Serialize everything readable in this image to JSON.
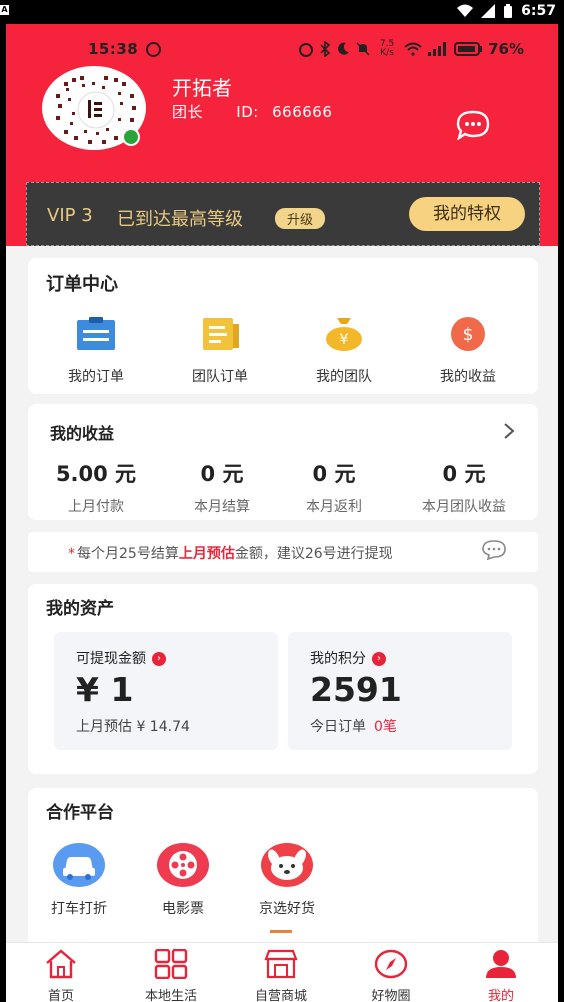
{
  "system_bar": {
    "time": "6:57",
    "app_letter": "A"
  },
  "inner_status": {
    "time": "15:38",
    "speed": "7.5 K/s",
    "battery": "76%"
  },
  "user": {
    "name": "开拓者",
    "role": "团长",
    "id_label": "ID:",
    "id_value": "666666"
  },
  "vip": {
    "level": "VIP 3",
    "desc": "已到达最高等级",
    "upgrade": "升级",
    "privilege_button": "我的特权"
  },
  "order_center": {
    "title": "订单中心",
    "items": [
      {
        "label": "我的订单",
        "icon": "clipboard-icon"
      },
      {
        "label": "团队订单",
        "icon": "document-icon"
      },
      {
        "label": "我的团队",
        "icon": "money-bag-icon"
      },
      {
        "label": "我的收益",
        "icon": "dollar-coin-icon"
      }
    ]
  },
  "earnings": {
    "title": "我的收益",
    "items": [
      {
        "value": "5.00 元",
        "label": "上月付款"
      },
      {
        "value": "0 元",
        "label": "本月结算"
      },
      {
        "value": "0 元",
        "label": "本月返利"
      },
      {
        "value": "0 元",
        "label": "本月团队收益"
      }
    ]
  },
  "notice": {
    "star": "*",
    "pre": "每个月25号结算",
    "highlight": "上月预估",
    "post": "金额，建议26号进行提现"
  },
  "assets": {
    "title": "我的资产",
    "withdrawable": {
      "label": "可提现金额",
      "value": "¥ 1",
      "sub": "上月预估 ¥ 14.74"
    },
    "points": {
      "label": "我的积分",
      "value": "2591",
      "sub": "今日订单",
      "sub_red": "0笔"
    }
  },
  "partners": {
    "title": "合作平台",
    "items": [
      {
        "label": "打车打折",
        "icon": "taxi-icon",
        "color": "#4f8ff0"
      },
      {
        "label": "电影票",
        "icon": "film-reel-icon",
        "color": "#ee3b50"
      },
      {
        "label": "京选好货",
        "icon": "dog-mascot-icon",
        "color": "#ef4048"
      }
    ]
  },
  "tabbar": [
    {
      "label": "首页",
      "icon": "home-icon"
    },
    {
      "label": "本地生活",
      "icon": "grid-icon"
    },
    {
      "label": "自营商城",
      "icon": "store-icon"
    },
    {
      "label": "好物圈",
      "icon": "compass-icon"
    },
    {
      "label": "我的",
      "icon": "user-icon"
    }
  ],
  "colors": {
    "brand_red": "#f5233b",
    "vip_gold": "#e8c982",
    "accent_red": "#e8243a"
  }
}
